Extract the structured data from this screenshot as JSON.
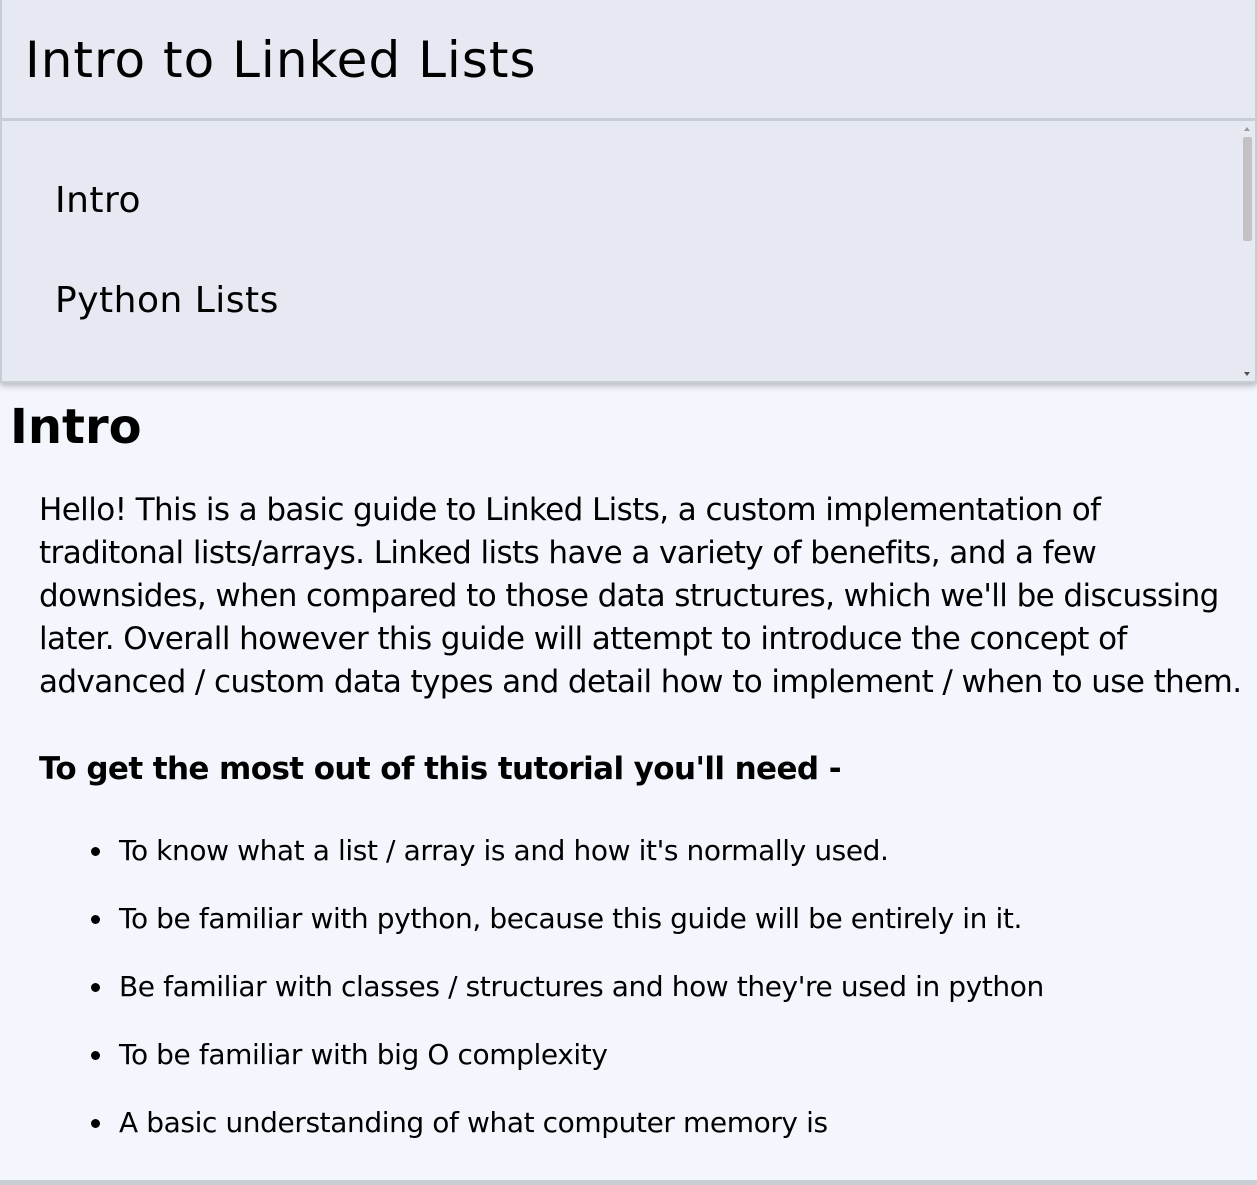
{
  "nav": {
    "title": "Intro to Linked Lists",
    "items": [
      {
        "label": "Intro"
      },
      {
        "label": "Python Lists"
      }
    ]
  },
  "main": {
    "section_title": "Intro",
    "paragraph": "Hello! This is a basic guide to Linked Lists, a custom implementation of traditonal lists/arrays. Linked lists have a variety of benefits, and a few downsides, when compared to those data structures, which we'll be discussing later. Overall however this guide will attempt to introduce the concept of advanced / custom data types and detail how to implement / when to use them.",
    "requirements_heading": "To get the most out of this tutorial you'll need -",
    "requirements": [
      "To know what a list / array is and how it's normally used.",
      "To be familiar with python, because this guide will be entirely in it.",
      "Be familiar with classes / structures and how they're used in python",
      "To be familiar with big O complexity",
      "A basic understanding of what computer memory is"
    ]
  }
}
